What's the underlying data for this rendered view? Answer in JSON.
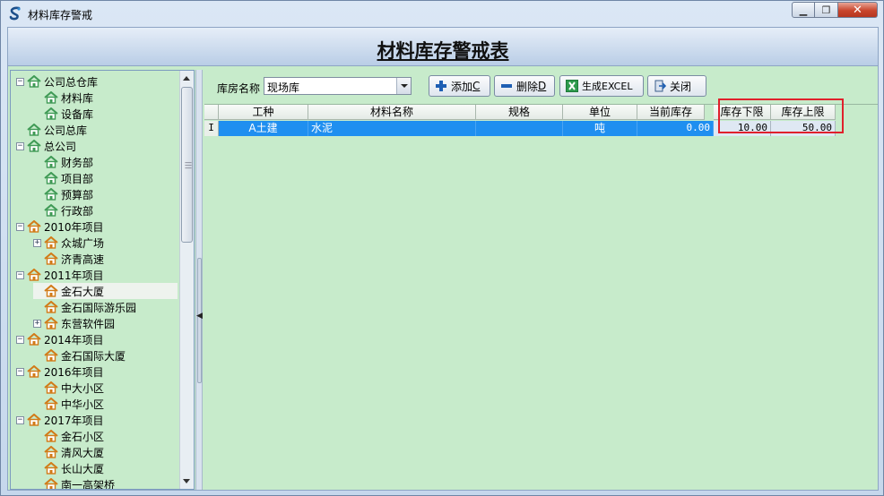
{
  "window": {
    "title": "材料库存警戒"
  },
  "page": {
    "title": "材料库存警戒表"
  },
  "colors": {
    "grid_bg": "#c7ebcb",
    "selection": "#1f8ff0",
    "highlight": "#e0202c"
  },
  "tree": {
    "items": [
      {
        "label": "公司总仓库",
        "level": 0,
        "expander": "⊟",
        "icon": "green-house-icon"
      },
      {
        "label": "材料库",
        "level": 1,
        "expander": "",
        "icon": "green-house-icon"
      },
      {
        "label": "设备库",
        "level": 1,
        "expander": "",
        "icon": "green-house-icon"
      },
      {
        "label": "公司总库",
        "level": 0,
        "expander": "",
        "icon": "green-house-icon"
      },
      {
        "label": "总公司",
        "level": 0,
        "expander": "⊟",
        "icon": "green-house-icon"
      },
      {
        "label": "财务部",
        "level": 1,
        "expander": "",
        "icon": "green-house-icon"
      },
      {
        "label": "项目部",
        "level": 1,
        "expander": "",
        "icon": "green-house-icon"
      },
      {
        "label": "预算部",
        "level": 1,
        "expander": "",
        "icon": "green-house-icon"
      },
      {
        "label": "行政部",
        "level": 1,
        "expander": "",
        "icon": "green-house-icon"
      },
      {
        "label": "2010年项目",
        "level": 0,
        "expander": "⊟",
        "icon": "orange-house-icon"
      },
      {
        "label": "众城广场",
        "level": 1,
        "expander": "⊞",
        "icon": "orange-house-icon"
      },
      {
        "label": "济青高速",
        "level": 1,
        "expander": "",
        "icon": "orange-house-icon"
      },
      {
        "label": "2011年项目",
        "level": 0,
        "expander": "⊟",
        "icon": "orange-house-icon"
      },
      {
        "label": "金石大厦",
        "level": 1,
        "expander": "",
        "icon": "orange-house-icon",
        "selected": true
      },
      {
        "label": "金石国际游乐园",
        "level": 1,
        "expander": "",
        "icon": "orange-house-icon"
      },
      {
        "label": "东营软件园",
        "level": 1,
        "expander": "⊞",
        "icon": "orange-house-icon"
      },
      {
        "label": "2014年项目",
        "level": 0,
        "expander": "⊟",
        "icon": "orange-house-icon"
      },
      {
        "label": "金石国际大厦",
        "level": 1,
        "expander": "",
        "icon": "orange-house-icon"
      },
      {
        "label": "2016年项目",
        "level": 0,
        "expander": "⊟",
        "icon": "orange-house-icon"
      },
      {
        "label": "中大小区",
        "level": 1,
        "expander": "",
        "icon": "orange-house-icon"
      },
      {
        "label": "中华小区",
        "level": 1,
        "expander": "",
        "icon": "orange-house-icon"
      },
      {
        "label": "2017年项目",
        "level": 0,
        "expander": "⊟",
        "icon": "orange-house-icon"
      },
      {
        "label": "金石小区",
        "level": 1,
        "expander": "",
        "icon": "orange-house-icon"
      },
      {
        "label": "清风大厦",
        "level": 1,
        "expander": "",
        "icon": "orange-house-icon"
      },
      {
        "label": "长山大厦",
        "level": 1,
        "expander": "",
        "icon": "orange-house-icon"
      },
      {
        "label": "南一高架桥",
        "level": 1,
        "expander": "",
        "icon": "orange-house-icon"
      }
    ]
  },
  "toolbar": {
    "warehouse_label": "库房名称",
    "warehouse_value": "现场库",
    "add_label": "添加",
    "add_hotkey": "C",
    "delete_label": "删除",
    "delete_hotkey": "D",
    "excel_label": "生成EXCEL",
    "close_label": "关闭"
  },
  "grid": {
    "columns": [
      "工种",
      "材料名称",
      "规格",
      "单位",
      "当前库存",
      "库存下限",
      "库存上限"
    ],
    "rows": [
      {
        "indicator": "I",
        "cells": [
          "A土建",
          "水泥",
          "",
          "吨",
          "0.00",
          "10.00",
          "50.00"
        ]
      }
    ]
  }
}
